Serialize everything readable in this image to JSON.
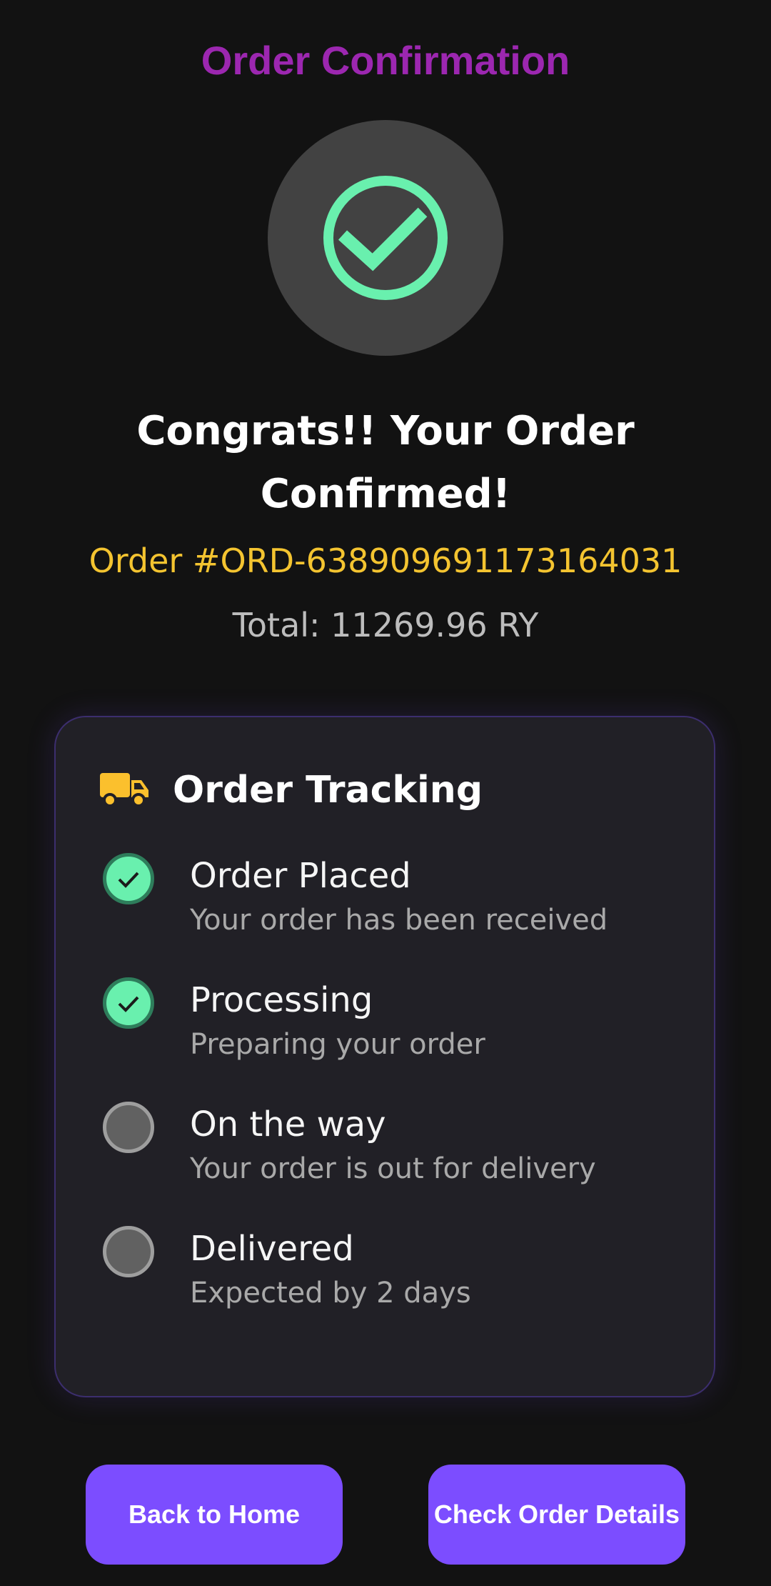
{
  "header": {
    "title": "Order Confirmation"
  },
  "hero": {
    "icon": "check-circle-icon",
    "accent": "#69f0ae"
  },
  "confirmation": {
    "headline": "Congrats!! Your Order Confirmed!",
    "order_number": "Order #ORD-638909691173164031",
    "total": "Total: 11269.96 RY"
  },
  "tracking": {
    "title": "Order Tracking",
    "icon": "truck-icon",
    "steps": [
      {
        "title": "Order Placed",
        "subtitle": "Your order has been received",
        "status": "done"
      },
      {
        "title": "Processing",
        "subtitle": "Preparing your order",
        "status": "done"
      },
      {
        "title": "On the way",
        "subtitle": "Your order is out for delivery",
        "status": "pending"
      },
      {
        "title": "Delivered",
        "subtitle": "Expected by 2 days",
        "status": "pending"
      }
    ]
  },
  "actions": {
    "back_home": "Back to Home",
    "check_details": "Check Order Details",
    "color": "#7c4dff"
  }
}
